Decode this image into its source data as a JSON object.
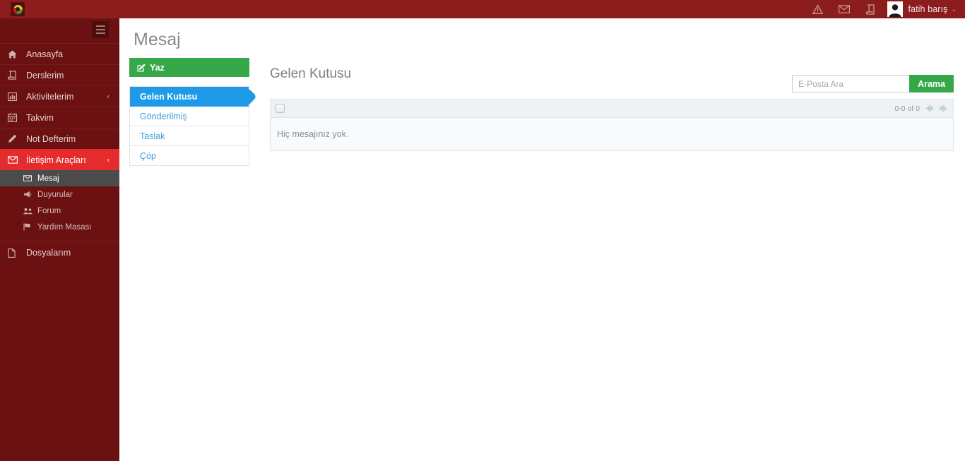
{
  "topbar": {
    "logo_name": "site-logo",
    "icons": [
      {
        "name": "alert-icon",
        "label": "Uyarılar"
      },
      {
        "name": "envelope-icon",
        "label": "Mesajlar"
      },
      {
        "name": "book-icon",
        "label": "Derslerim"
      }
    ],
    "user": {
      "name": "fatih barış",
      "caret": "⌄"
    }
  },
  "sidebar": {
    "toggle_label": "menu-toggle",
    "items": [
      {
        "label": "Anasayfa",
        "icon": "home-icon",
        "active": false,
        "caret": ""
      },
      {
        "label": "Derslerim",
        "icon": "book-icon",
        "active": false,
        "caret": ""
      },
      {
        "label": "Aktivitelerim",
        "icon": "bar-chart-icon",
        "active": false,
        "caret": "‹"
      },
      {
        "label": "Takvim",
        "icon": "calendar-icon",
        "active": false,
        "caret": ""
      },
      {
        "label": "Not Defterim",
        "icon": "pencil-icon",
        "active": false,
        "caret": ""
      },
      {
        "label": "İletişim Araçları",
        "icon": "envelope-icon",
        "active": true,
        "caret": "‹"
      }
    ],
    "subitems": [
      {
        "label": "Mesaj",
        "icon": "envelope-icon",
        "active": true
      },
      {
        "label": "Duyurular",
        "icon": "megaphone-icon",
        "active": false
      },
      {
        "label": "Forum",
        "icon": "users-icon",
        "active": false
      },
      {
        "label": "Yardım Masası",
        "icon": "flag-icon",
        "active": false
      }
    ],
    "footer_item": {
      "label": "Dosyalarım",
      "icon": "file-icon",
      "active": false
    }
  },
  "main": {
    "page_title": "Mesaj",
    "compose": {
      "label": "Yaz",
      "icon": "compose-icon"
    },
    "folders": [
      {
        "label": "Gelen Kutusu",
        "active": true
      },
      {
        "label": "Gönderilmiş",
        "active": false
      },
      {
        "label": "Taslak",
        "active": false
      },
      {
        "label": "Çöp",
        "active": false
      }
    ],
    "inbox_title": "Gelen Kutusu",
    "search": {
      "placeholder": "E-Posta Ara",
      "value": "",
      "button_label": "Arama"
    },
    "toolbar": {
      "select_all_name": "select-all-checkbox",
      "pager_count": "0-0 of 0",
      "prev_arrow": "‹",
      "next_arrow": "›"
    },
    "empty_text": "Hiç mesajınız yok."
  },
  "colors": {
    "topbar": "#8c1d1d",
    "sidebar": "#6b1111",
    "active_red": "#e52b2b",
    "active_sub_gray": "#4b4b4b",
    "green": "#37a84a",
    "blue": "#1f9ae8",
    "panel_header": "#eef2f5",
    "panel_body": "#f7fbfd"
  }
}
